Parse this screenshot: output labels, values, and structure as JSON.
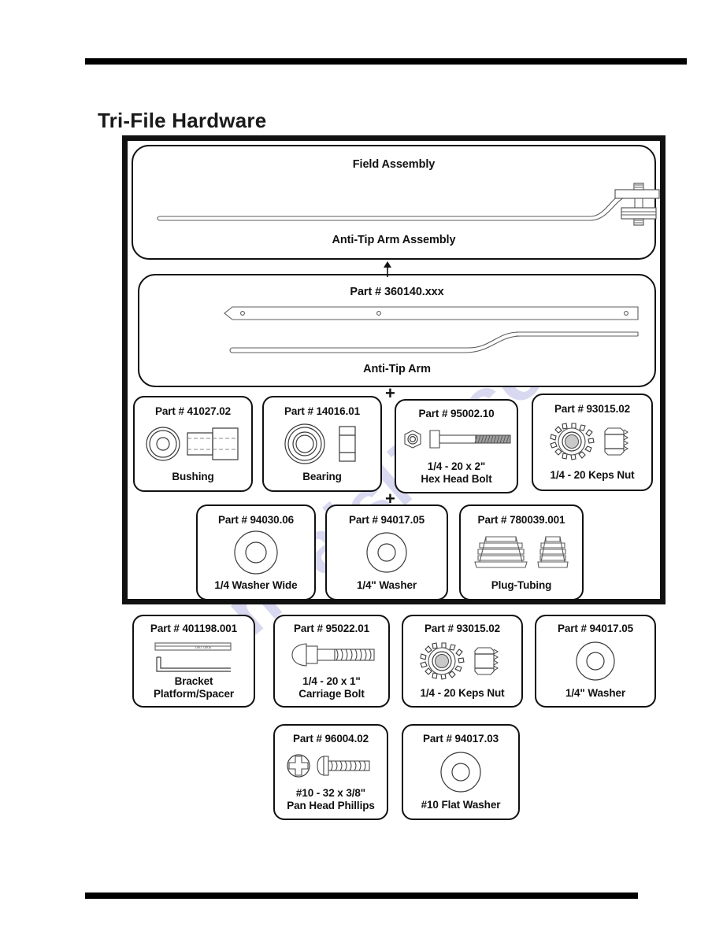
{
  "page": {
    "title": "Tri-File Hardware",
    "watermark": "manualslib.com"
  },
  "assembly_panel": {
    "top_label": "Field Assembly",
    "bottom_label": "Anti-Tip Arm Assembly",
    "icon": "anti-tip-arm-assembly-drawing"
  },
  "arm_panel": {
    "part_label": "Part # 360140.xxx",
    "bottom_label": "Anti-Tip Arm",
    "icon": "anti-tip-arm-drawing"
  },
  "connectors": {
    "arrow_up": "arrow-up-icon",
    "plus_1": "+",
    "plus_2": "+"
  },
  "parts_row_1": [
    {
      "part": "Part # 41027.02",
      "name": "Bushing",
      "line2": "",
      "icon": "bushing-icon"
    },
    {
      "part": "Part # 14016.01",
      "name": "Bearing",
      "line2": "",
      "icon": "bearing-icon"
    },
    {
      "part": "Part # 95002.10",
      "name": "1/4 - 20 x 2\"",
      "line2": "Hex Head Bolt",
      "icon": "hex-head-bolt-icon"
    },
    {
      "part": "Part # 93015.02",
      "name": "1/4 - 20 Keps Nut",
      "line2": "",
      "icon": "keps-nut-icon"
    }
  ],
  "parts_row_2": [
    {
      "part": "Part # 94030.06",
      "name": "1/4 Washer Wide",
      "line2": "",
      "icon": "wide-washer-icon"
    },
    {
      "part": "Part # 94017.05",
      "name": "1/4\" Washer",
      "line2": "",
      "icon": "washer-icon"
    },
    {
      "part": "Part # 780039.001",
      "name": "Plug-Tubing",
      "line2": "",
      "icon": "plug-tubing-icon"
    }
  ],
  "parts_row_3": [
    {
      "part": "Part # 401198.001",
      "name": "Bracket",
      "line2": "Platform/Spacer",
      "icon": "bracket-icon"
    },
    {
      "part": "Part # 95022.01",
      "name": "1/4 - 20 x 1\"",
      "line2": "Carriage Bolt",
      "icon": "carriage-bolt-icon"
    },
    {
      "part": "Part # 93015.02",
      "name": "1/4 - 20 Keps Nut",
      "line2": "",
      "icon": "keps-nut-icon"
    },
    {
      "part": "Part # 94017.05",
      "name": "1/4\" Washer",
      "line2": "",
      "icon": "washer-icon"
    }
  ],
  "parts_row_4": [
    {
      "part": "Part # 96004.02",
      "name": "#10 - 32 x 3/8\"",
      "line2": "Pan Head Phillips",
      "icon": "pan-head-phillips-icon"
    },
    {
      "part": "Part # 94017.03",
      "name": "#10 Flat Washer",
      "line2": "",
      "icon": "flat-washer-icon"
    }
  ]
}
